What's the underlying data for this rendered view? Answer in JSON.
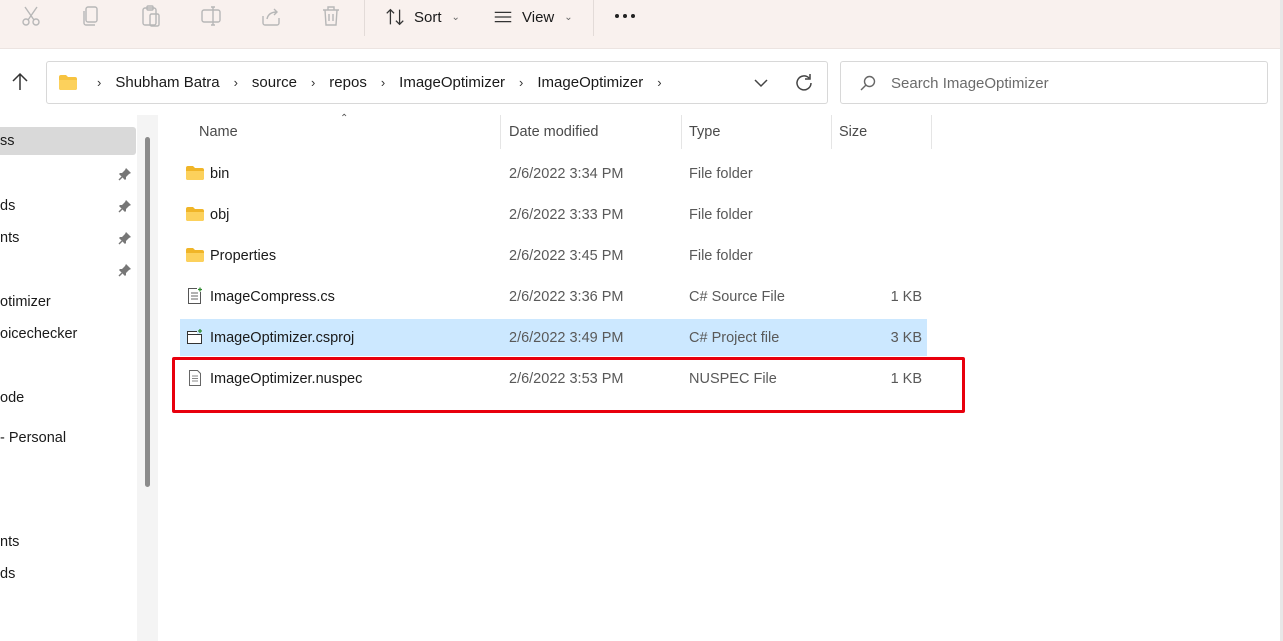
{
  "toolbar": {
    "disabled_icons": [
      "cut-icon",
      "copy-icon",
      "paste-icon",
      "rename-icon",
      "share-icon",
      "delete-icon"
    ],
    "sort_label": "Sort",
    "view_label": "View",
    "more_icon": "more-icon"
  },
  "address": {
    "breadcrumbs": [
      "Shubham Batra",
      "source",
      "repos",
      "ImageOptimizer",
      "ImageOptimizer"
    ]
  },
  "search": {
    "placeholder": "Search ImageOptimizer"
  },
  "nav": {
    "items": [
      {
        "label": "ss",
        "selected": true,
        "pinned": false
      },
      {
        "label": "",
        "selected": false,
        "pinned": true
      },
      {
        "label": "ds",
        "selected": false,
        "pinned": true
      },
      {
        "label": "nts",
        "selected": false,
        "pinned": true
      },
      {
        "label": "",
        "selected": false,
        "pinned": true
      },
      {
        "label": "otimizer",
        "selected": false,
        "pinned": false
      },
      {
        "label": "oicechecker",
        "selected": false,
        "pinned": false
      },
      {
        "label": "ode",
        "selected": false,
        "pinned": false
      },
      {
        "label": "- Personal",
        "selected": false,
        "pinned": false
      },
      {
        "label": "nts",
        "selected": false,
        "pinned": false
      },
      {
        "label": "ds",
        "selected": false,
        "pinned": false
      }
    ]
  },
  "columns": {
    "name": "Name",
    "date": "Date modified",
    "type": "Type",
    "size": "Size"
  },
  "files": [
    {
      "name": "bin",
      "date": "2/6/2022 3:34 PM",
      "type": "File folder",
      "size": "",
      "icon": "folder-icon",
      "selected": false
    },
    {
      "name": "obj",
      "date": "2/6/2022 3:33 PM",
      "type": "File folder",
      "size": "",
      "icon": "folder-icon",
      "selected": false
    },
    {
      "name": "Properties",
      "date": "2/6/2022 3:45 PM",
      "type": "File folder",
      "size": "",
      "icon": "folder-icon",
      "selected": false
    },
    {
      "name": "ImageCompress.cs",
      "date": "2/6/2022 3:36 PM",
      "type": "C# Source File",
      "size": "1 KB",
      "icon": "csharp-file-icon",
      "selected": false
    },
    {
      "name": "ImageOptimizer.csproj",
      "date": "2/6/2022 3:49 PM",
      "type": "C# Project file",
      "size": "3 KB",
      "icon": "csproj-file-icon",
      "selected": true
    },
    {
      "name": "ImageOptimizer.nuspec",
      "date": "2/6/2022 3:53 PM",
      "type": "NUSPEC File",
      "size": "1 KB",
      "icon": "text-file-icon",
      "selected": false
    }
  ],
  "annotation": {
    "color": "#e8000d",
    "target": "ImageOptimizer.nuspec"
  }
}
